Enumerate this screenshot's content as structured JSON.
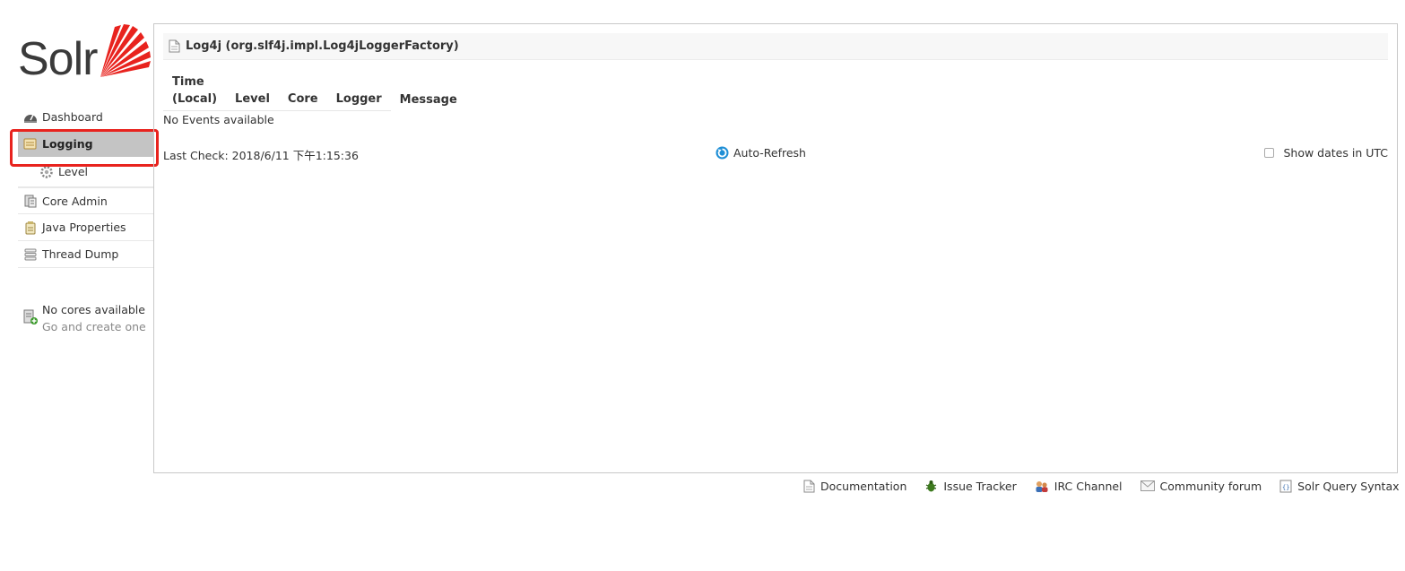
{
  "logo": {
    "wordmark": "Solr",
    "accent_color": "#e8231e"
  },
  "nav": {
    "items": [
      {
        "label": "Dashboard",
        "icon": "dashboard-icon"
      },
      {
        "label": "Logging",
        "icon": "logging-icon",
        "active": true
      },
      {
        "label": "Level",
        "icon": "gear-icon"
      },
      {
        "label": "Core Admin",
        "icon": "core-admin-icon"
      },
      {
        "label": "Java Properties",
        "icon": "java-icon"
      },
      {
        "label": "Thread Dump",
        "icon": "thread-dump-icon"
      }
    ],
    "cores": {
      "line1": "No cores available",
      "line2": "Go and create one"
    }
  },
  "main": {
    "title": "Log4j (org.slf4j.impl.Log4jLoggerFactory)",
    "columns": {
      "time_line1": "Time",
      "time_line2": "(Local)",
      "level": "Level",
      "core": "Core",
      "logger": "Logger",
      "message": "Message"
    },
    "empty": "No Events available",
    "last_check": "Last Check: 2018/6/11 下午1:15:36",
    "auto_refresh": "Auto-Refresh",
    "show_utc": "Show dates in UTC"
  },
  "footer": {
    "links": [
      {
        "label": "Documentation",
        "icon": "document-icon"
      },
      {
        "label": "Issue Tracker",
        "icon": "bug-icon"
      },
      {
        "label": "IRC Channel",
        "icon": "irc-icon"
      },
      {
        "label": "Community forum",
        "icon": "mail-icon"
      },
      {
        "label": "Solr Query Syntax",
        "icon": "query-syntax-icon"
      }
    ]
  }
}
